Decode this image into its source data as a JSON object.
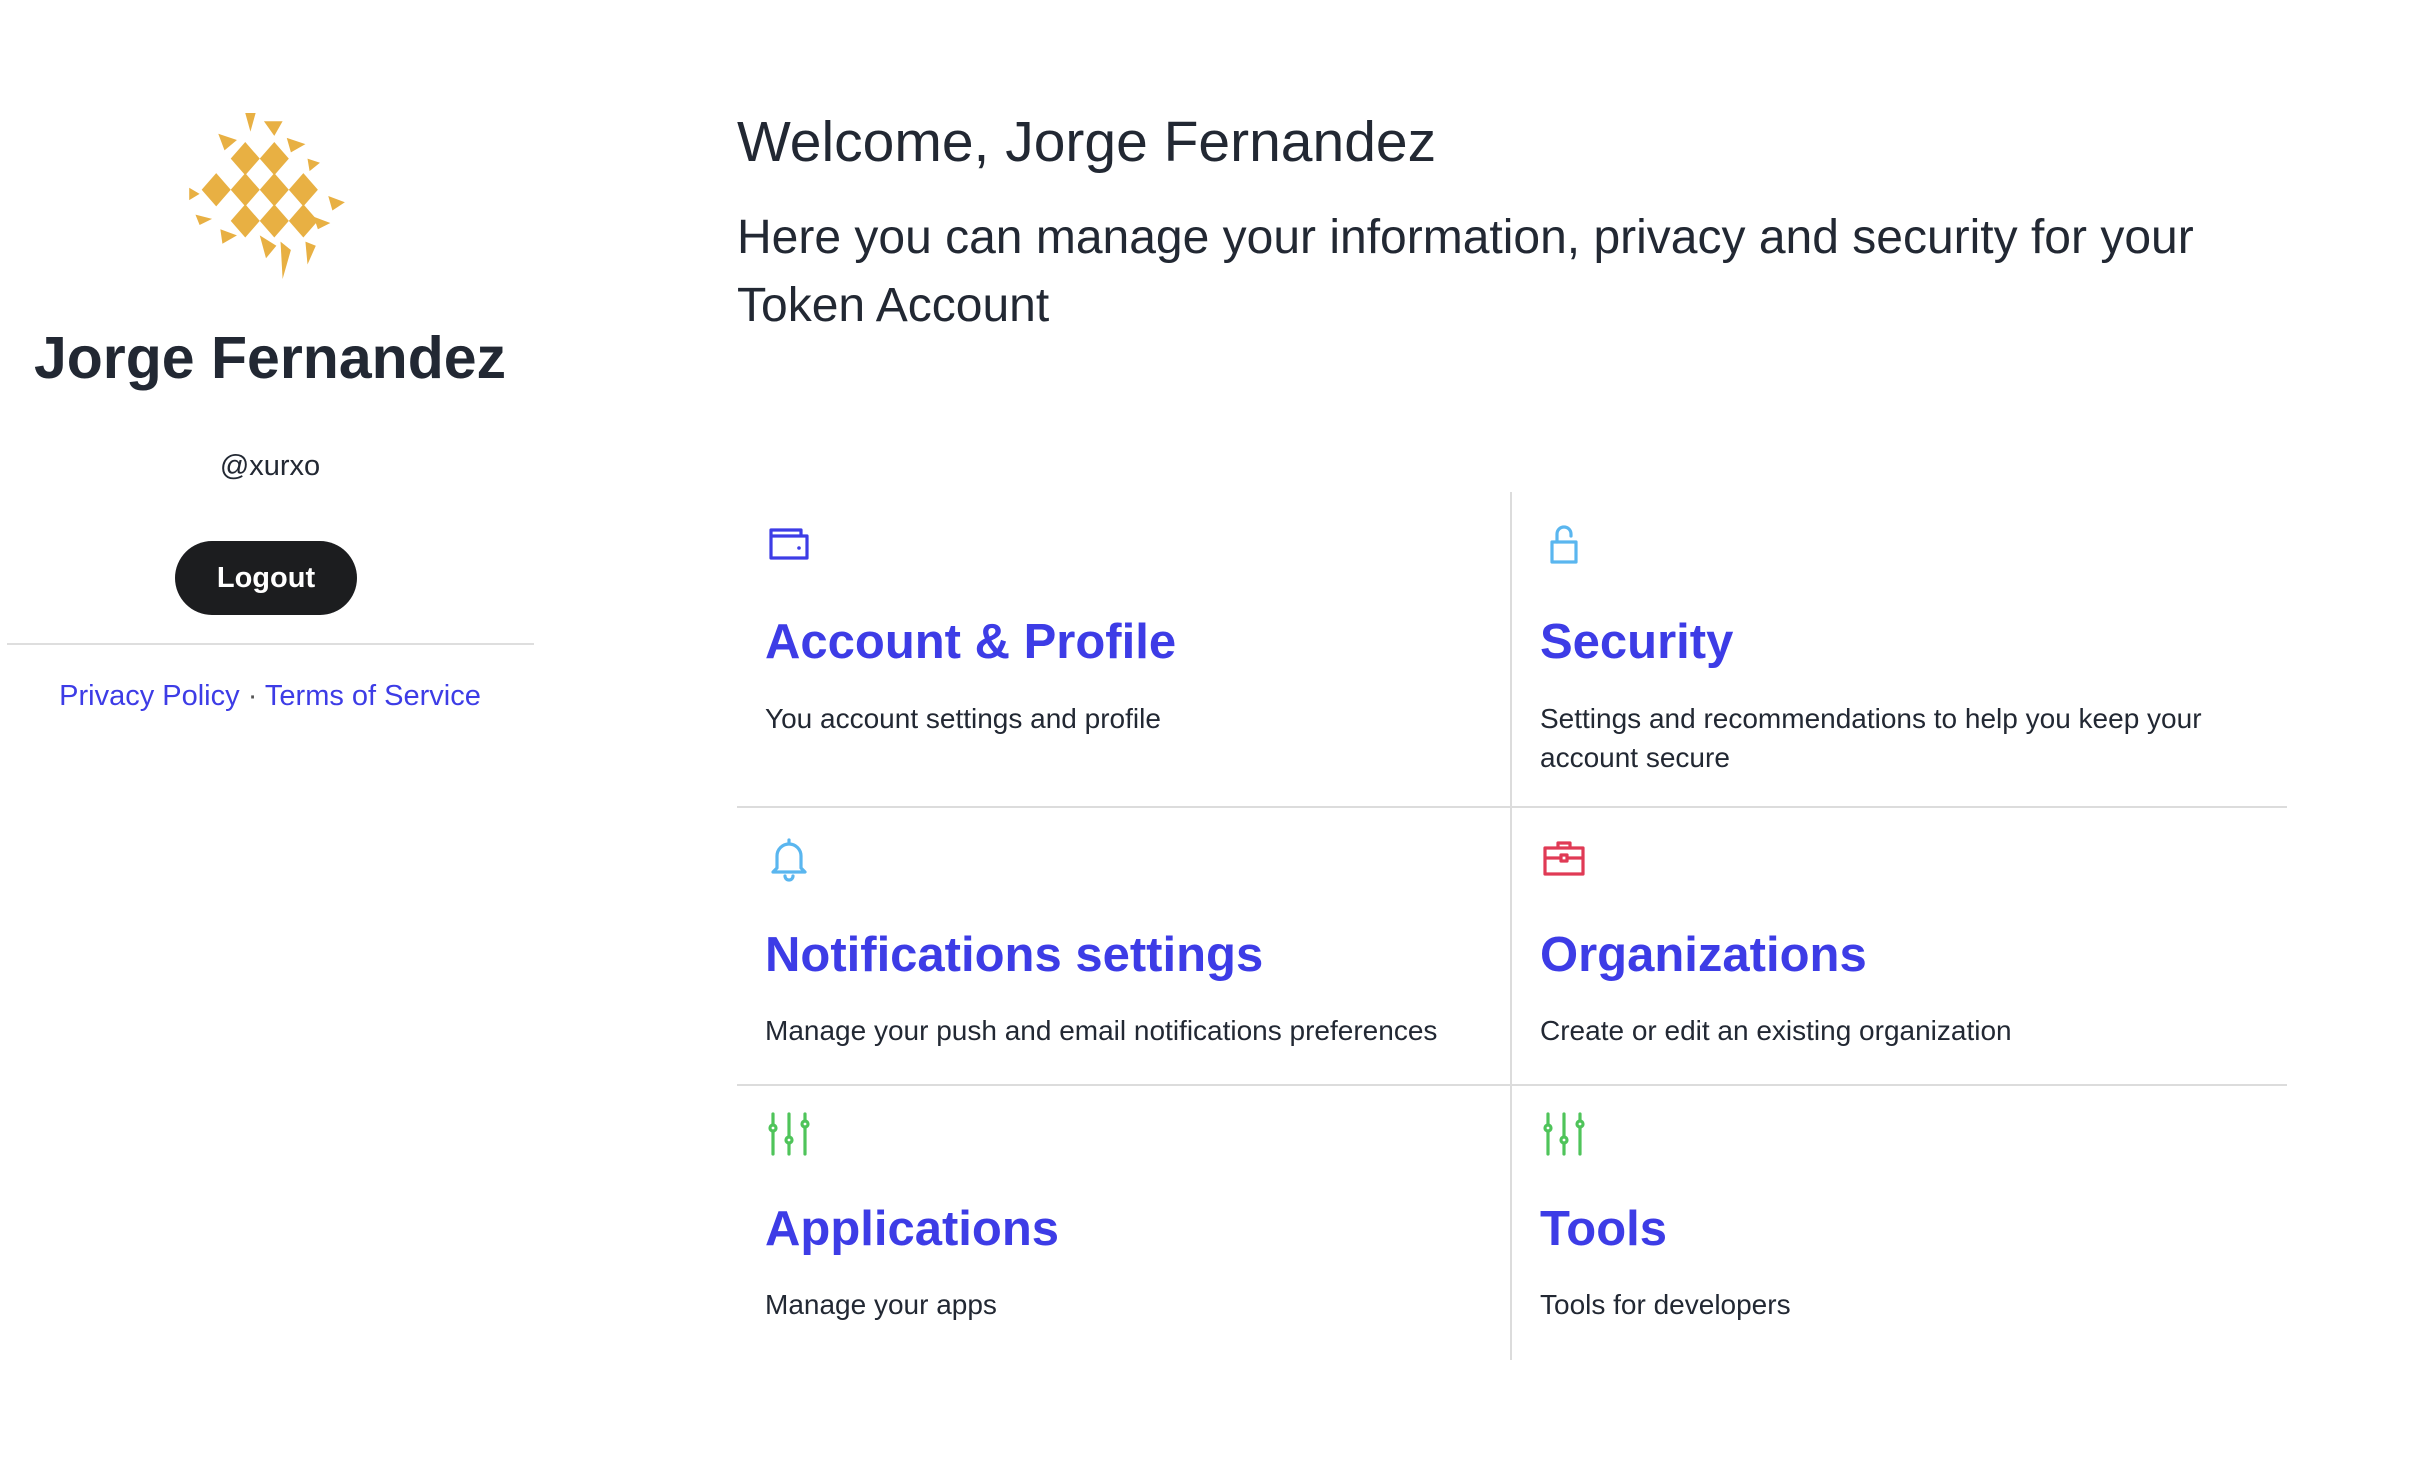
{
  "user": {
    "name": "Jorge Fernandez",
    "handle": "@xurxo",
    "logout_label": "Logout"
  },
  "footer": {
    "privacy_label": "Privacy Policy",
    "separator": "·",
    "terms_label": "Terms of Service"
  },
  "main": {
    "title": "Welcome, Jorge Fernandez",
    "subtitle": "Here you can manage your information, privacy and security for your Token Account"
  },
  "cards": [
    {
      "title": "Account & Profile",
      "description": "You account settings and profile",
      "icon": "wallet-icon",
      "color": "#3d3ce6"
    },
    {
      "title": "Security",
      "description": "Settings and recommendations to help you keep your account secure",
      "icon": "unlock-icon",
      "color": "#5ab6ef"
    },
    {
      "title": "Notifications settings",
      "description": "Manage your push and email notifications preferences",
      "icon": "bell-icon",
      "color": "#5ab6ef"
    },
    {
      "title": "Organizations",
      "description": "Create or edit an existing organization",
      "icon": "briefcase-icon",
      "color": "#e03a55"
    },
    {
      "title": "Applications",
      "description": "Manage your apps",
      "icon": "sliders-icon",
      "color": "#4fc45a"
    },
    {
      "title": "Tools",
      "description": "Tools for developers",
      "icon": "sliders-icon",
      "color": "#4fc45a"
    }
  ],
  "colors": {
    "accent": "#3d3ce6",
    "text": "#222833",
    "avatar": "#e8b043"
  }
}
